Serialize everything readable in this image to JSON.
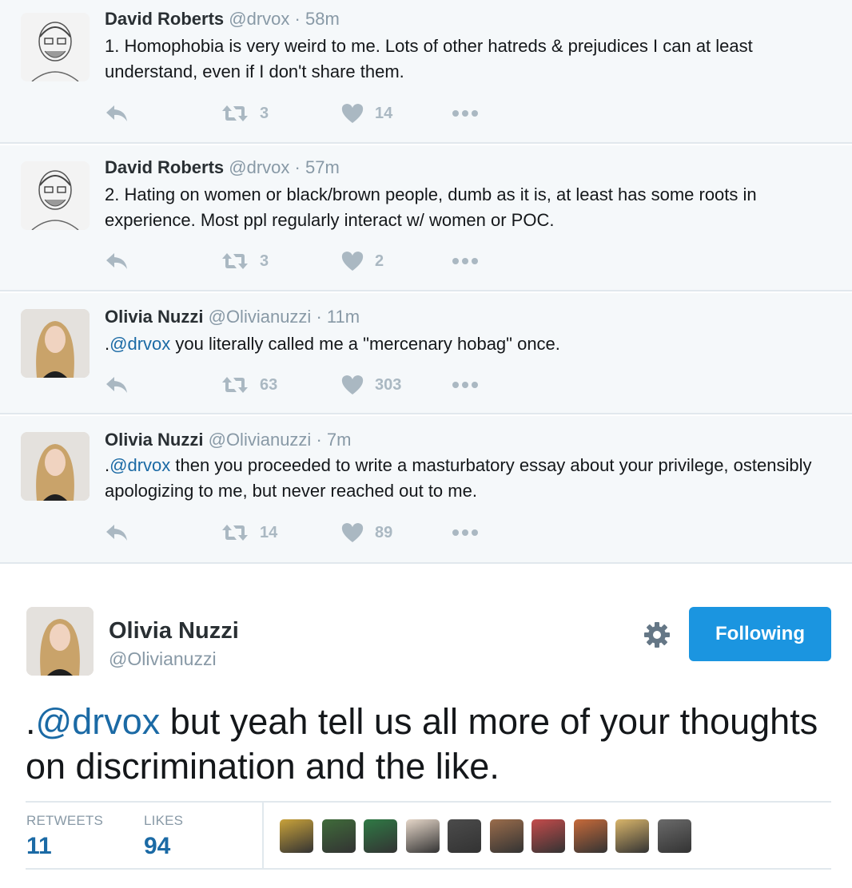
{
  "thread": [
    {
      "fullname": "David Roberts",
      "username": "@drvox",
      "dot": "·",
      "time": "58m",
      "text_prefix": "",
      "text": "1. Homophobia is very weird to me. Lots of other hatreds & prejudices I can at least understand, even if I don't share them.",
      "retweets": "3",
      "likes": "14",
      "avatar": "sketch"
    },
    {
      "fullname": "David Roberts",
      "username": "@drvox",
      "dot": "·",
      "time": "57m",
      "text_prefix": "",
      "text": "2. Hating on women or black/brown people, dumb as it is, at least has some roots in experience. Most ppl regularly interact w/ women or POC.",
      "retweets": "3",
      "likes": "2",
      "avatar": "sketch"
    },
    {
      "fullname": "Olivia Nuzzi",
      "username": "@Olivianuzzi",
      "dot": "·",
      "time": "11m",
      "text_prefix": ".",
      "mention": "@drvox",
      "text": " you literally called me a \"mercenary hobag\" once.",
      "retweets": "63",
      "likes": "303",
      "avatar": "photo"
    },
    {
      "fullname": "Olivia Nuzzi",
      "username": "@Olivianuzzi",
      "dot": "·",
      "time": "7m",
      "text_prefix": ".",
      "mention": "@drvox",
      "text": " then you proceeded to write a masturbatory essay about your privilege, ostensibly apologizing to me, but never reached out to me.",
      "retweets": "14",
      "likes": "89",
      "avatar": "photo"
    }
  ],
  "main_tweet": {
    "fullname": "Olivia Nuzzi",
    "username": "@Olivianuzzi",
    "follow_label": "Following",
    "text_prefix": ".",
    "mention": "@drvox",
    "text": " but yeah tell us all more of your thoughts on discrimination and the like.",
    "stats": {
      "retweets_label": "RETWEETS",
      "retweets_value": "11",
      "likes_label": "LIKES",
      "likes_value": "94"
    },
    "liker_avatar_colors": [
      "#c9a23a",
      "#3f6b3a",
      "#2f7a45",
      "#e6d7c9",
      "#4b4b4b",
      "#9a6c4b",
      "#c44b4b",
      "#c76a3a",
      "#d9b56a",
      "#6a6a6a"
    ]
  },
  "icons": {
    "reply": "reply-icon",
    "retweet": "retweet-icon",
    "like": "heart-icon",
    "more": "more-icon",
    "settings": "gear-icon"
  },
  "colors": {
    "link": "#1b6aa5",
    "button": "#1b95e0",
    "thread_bg": "#f5f8fa",
    "muted": "#8899a6"
  }
}
